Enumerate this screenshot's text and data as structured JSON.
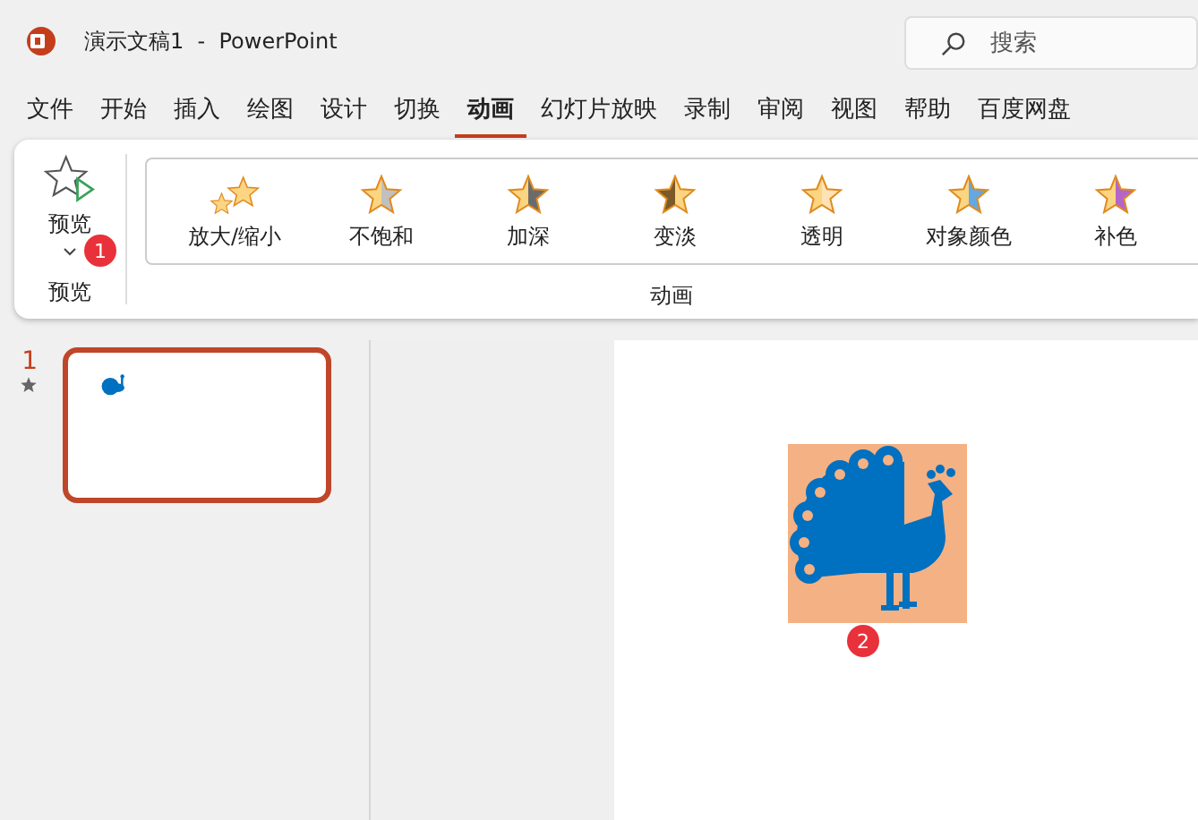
{
  "window": {
    "title": "演示文稿1  -  PowerPoint"
  },
  "search": {
    "placeholder": "搜索"
  },
  "tabs": [
    {
      "label": "文件",
      "selected": false
    },
    {
      "label": "开始",
      "selected": false
    },
    {
      "label": "插入",
      "selected": false
    },
    {
      "label": "绘图",
      "selected": false
    },
    {
      "label": "设计",
      "selected": false
    },
    {
      "label": "切换",
      "selected": false
    },
    {
      "label": "动画",
      "selected": true
    },
    {
      "label": "幻灯片放映",
      "selected": false
    },
    {
      "label": "录制",
      "selected": false
    },
    {
      "label": "审阅",
      "selected": false
    },
    {
      "label": "视图",
      "selected": false
    },
    {
      "label": "帮助",
      "selected": false
    },
    {
      "label": "百度网盘",
      "selected": false
    }
  ],
  "ribbon": {
    "preview": {
      "label": "预览",
      "group_label": "预览",
      "badge": "1"
    },
    "effects": [
      {
        "label": "放大/缩小",
        "kind": "pair",
        "color": "#fcd582"
      },
      {
        "label": "不饱和",
        "kind": "split",
        "color": "#c0c0c0"
      },
      {
        "label": "加深",
        "kind": "split",
        "color": "#6b6b6b"
      },
      {
        "label": "变淡",
        "kind": "shade",
        "color": "#7a5a2a"
      },
      {
        "label": "透明",
        "kind": "split",
        "color": "#fde3b5"
      },
      {
        "label": "对象颜色",
        "kind": "split",
        "color": "#63a8e0"
      },
      {
        "label": "补色",
        "kind": "split",
        "color": "#b565c9"
      }
    ],
    "group_label": "动画"
  },
  "slides": [
    {
      "number": "1",
      "selected": true
    }
  ],
  "canvas": {
    "badge": "2"
  }
}
